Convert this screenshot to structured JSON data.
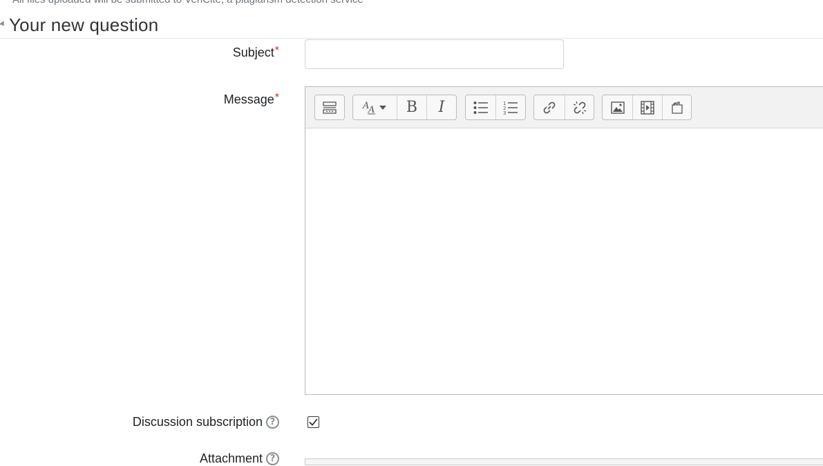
{
  "notice": "All files uploaded will be submitted to VeriCite, a plagiarism detection service",
  "section": {
    "title": "Your new question"
  },
  "form": {
    "subject": {
      "label": "Subject",
      "value": "",
      "required_mark": "*"
    },
    "message": {
      "label": "Message",
      "required_mark": "*",
      "content": ""
    },
    "subscription": {
      "label": "Discussion subscription",
      "checked": true,
      "help": "?"
    },
    "attachment": {
      "label": "Attachment",
      "help": "?"
    }
  },
  "toolbar": {
    "groups": [
      [
        "toolbar-toggle-icon"
      ],
      [
        "font-style-icon",
        "bold-icon",
        "italic-icon"
      ],
      [
        "bullet-list-icon",
        "numbered-list-icon"
      ],
      [
        "link-icon",
        "unlink-icon"
      ],
      [
        "image-icon",
        "media-icon",
        "manage-files-icon"
      ]
    ],
    "bold_glyph": "B",
    "italic_glyph": "I"
  },
  "colors": {
    "required": "#ca3120",
    "toolbar_bg": "#f2f2f2"
  }
}
